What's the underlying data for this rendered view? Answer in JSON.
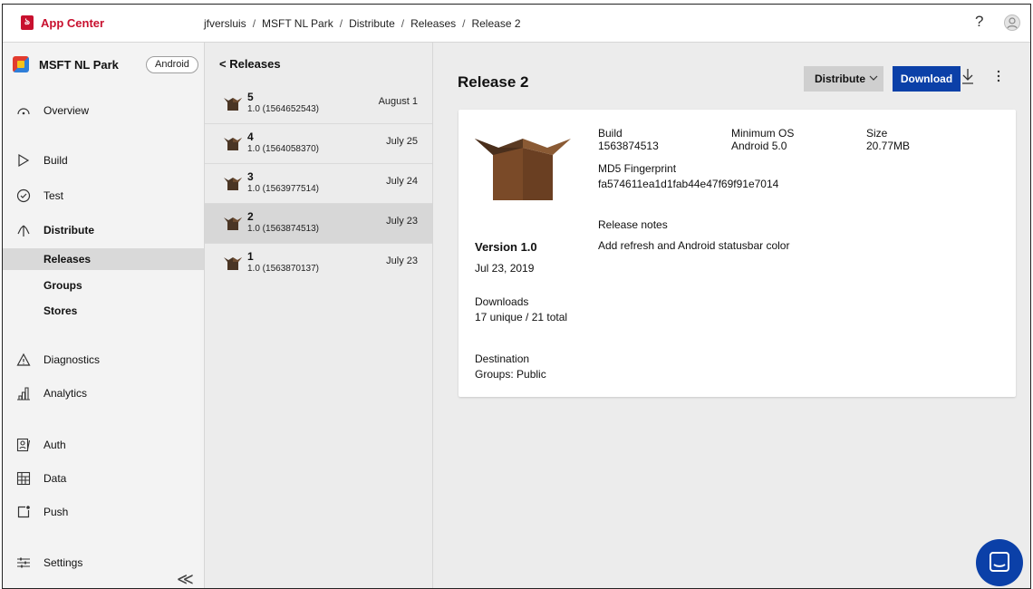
{
  "header": {
    "app_name": "App Center",
    "breadcrumb": [
      "jfversluis",
      "MSFT NL Park",
      "Distribute",
      "Releases",
      "Release 2"
    ],
    "help_glyph": "?"
  },
  "sidebar": {
    "app_title": "MSFT NL Park",
    "platform": "Android",
    "items": [
      {
        "label": "Overview",
        "icon": "overview-gauge-icon"
      },
      {
        "label": "Build",
        "icon": "play-triangle-icon"
      },
      {
        "label": "Test",
        "icon": "check-circle-icon"
      },
      {
        "label": "Distribute",
        "icon": "distribute-arrows-icon"
      },
      {
        "label": "Diagnostics",
        "icon": "warning-triangle-icon"
      },
      {
        "label": "Analytics",
        "icon": "bar-chart-icon"
      },
      {
        "label": "Auth",
        "icon": "auth-icon"
      },
      {
        "label": "Data",
        "icon": "data-table-icon"
      },
      {
        "label": "Push",
        "icon": "push-square-icon"
      },
      {
        "label": "Settings",
        "icon": "sliders-icon"
      }
    ],
    "sub_items": [
      {
        "label": "Releases"
      },
      {
        "label": "Groups"
      },
      {
        "label": "Stores"
      }
    ],
    "collapse_glyph": "≪"
  },
  "releases_panel": {
    "back_label": "< Releases",
    "releases": [
      {
        "number": "5",
        "version": "1.0 (1564652543)",
        "date": "August 1"
      },
      {
        "number": "4",
        "version": "1.0 (1564058370)",
        "date": "July 25"
      },
      {
        "number": "3",
        "version": "1.0 (1563977514)",
        "date": "July 24"
      },
      {
        "number": "2",
        "version": "1.0 (1563874513)",
        "date": "July 23"
      },
      {
        "number": "1",
        "version": "1.0 (1563870137)",
        "date": "July 23"
      }
    ],
    "selected_index": 3
  },
  "release": {
    "title": "Release 2",
    "distribute_label": "Distribute",
    "download_label": "Download",
    "version": "Version 1.0",
    "date": "Jul 23, 2019",
    "downloads_label": "Downloads",
    "downloads_value": "17 unique / 21 total",
    "destination_label": "Destination",
    "destination_value": "Groups: Public",
    "build_label": "Build",
    "build_value": "1563874513",
    "min_os_label": "Minimum OS",
    "min_os_value": "Android 5.0",
    "size_label": "Size",
    "size_value": "20.77MB",
    "md5_label": "MD5 Fingerprint",
    "md5_value": "fa574611ea1d1fab44e47f69f91e7014",
    "notes_label": "Release notes",
    "notes_value": "Add refresh and Android statusbar color"
  },
  "colors": {
    "brand": "#c8102e",
    "primary_button": "#0b40a8",
    "box_brown": "#7a4a28"
  }
}
